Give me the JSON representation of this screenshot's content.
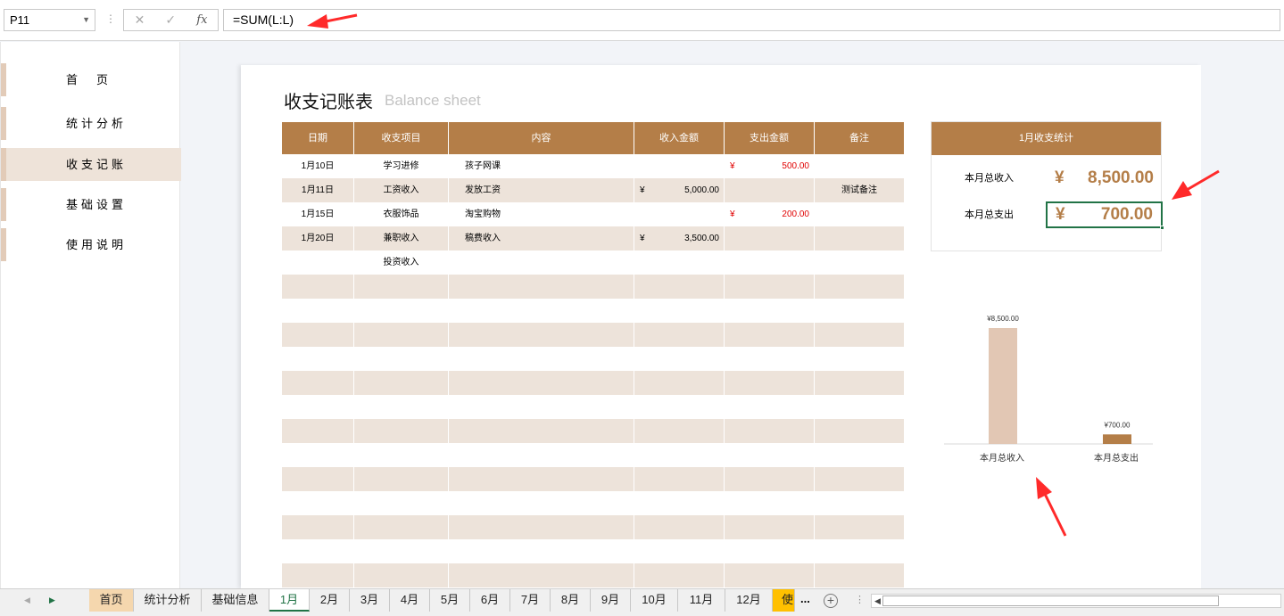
{
  "formula_bar": {
    "name_box": "P11",
    "cancel_icon": "✕",
    "confirm_icon": "✓",
    "fx_label": "fx",
    "formula": "=SUM(L:L)"
  },
  "nav": {
    "items": [
      {
        "label": "首　页"
      },
      {
        "label": "统计分析"
      },
      {
        "label": "收支记账",
        "active": true
      },
      {
        "label": "基础设置"
      },
      {
        "label": "使用说明"
      }
    ]
  },
  "sheet": {
    "title": "收支记账表",
    "subtitle": "Balance sheet"
  },
  "table": {
    "headers": [
      "日期",
      "收支项目",
      "内容",
      "收入金额",
      "支出金额",
      "备注"
    ],
    "rows": [
      {
        "date": "1月10日",
        "item": "学习进修",
        "content": "孩子网课",
        "income_sym": "",
        "income": "",
        "expense_sym": "¥",
        "expense": "500.00",
        "note": ""
      },
      {
        "date": "1月11日",
        "item": "工资收入",
        "content": "发放工资",
        "income_sym": "¥",
        "income": "5,000.00",
        "expense_sym": "",
        "expense": "",
        "note": "测试备注"
      },
      {
        "date": "1月15日",
        "item": "衣服饰品",
        "content": "淘宝购物",
        "income_sym": "",
        "income": "",
        "expense_sym": "¥",
        "expense": "200.00",
        "note": ""
      },
      {
        "date": "1月20日",
        "item": "兼职收入",
        "content": "稿费收入",
        "income_sym": "¥",
        "income": "3,500.00",
        "expense_sym": "",
        "expense": "",
        "note": ""
      },
      {
        "date": "",
        "item": "投资收入",
        "content": "",
        "income_sym": "",
        "income": "",
        "expense_sym": "",
        "expense": "",
        "note": ""
      }
    ],
    "empty_rows": 13
  },
  "stats": {
    "header": "1月收支统计",
    "income_label": "本月总收入",
    "income_symbol": "¥",
    "income_value": "8,500.00",
    "expense_label": "本月总支出",
    "expense_symbol": "¥",
    "expense_value": "700.00"
  },
  "chart_data": {
    "type": "bar",
    "categories": [
      "本月总收入",
      "本月总支出"
    ],
    "values": [
      8500,
      700
    ],
    "data_labels": [
      "¥8,500.00",
      "¥700.00"
    ],
    "colors": [
      "#e2c7b4",
      "#b47e48"
    ],
    "ylim": [
      0,
      8500
    ],
    "grid": false
  },
  "tabs": {
    "items": [
      {
        "label": "首页",
        "style": "tan"
      },
      {
        "label": "统计分析"
      },
      {
        "label": "基础信息"
      },
      {
        "label": "1月",
        "style": "active"
      },
      {
        "label": "2月"
      },
      {
        "label": "3月"
      },
      {
        "label": "4月"
      },
      {
        "label": "5月"
      },
      {
        "label": "6月"
      },
      {
        "label": "7月"
      },
      {
        "label": "8月"
      },
      {
        "label": "9月"
      },
      {
        "label": "10月"
      },
      {
        "label": "11月"
      },
      {
        "label": "12月"
      },
      {
        "label": "使",
        "style": "gold"
      }
    ],
    "more": "...",
    "add": "+"
  },
  "colors": {
    "accent": "#b47e48",
    "row_alt": "#ede3da",
    "selection": "#217346",
    "annotation": "#ff2a2a"
  }
}
